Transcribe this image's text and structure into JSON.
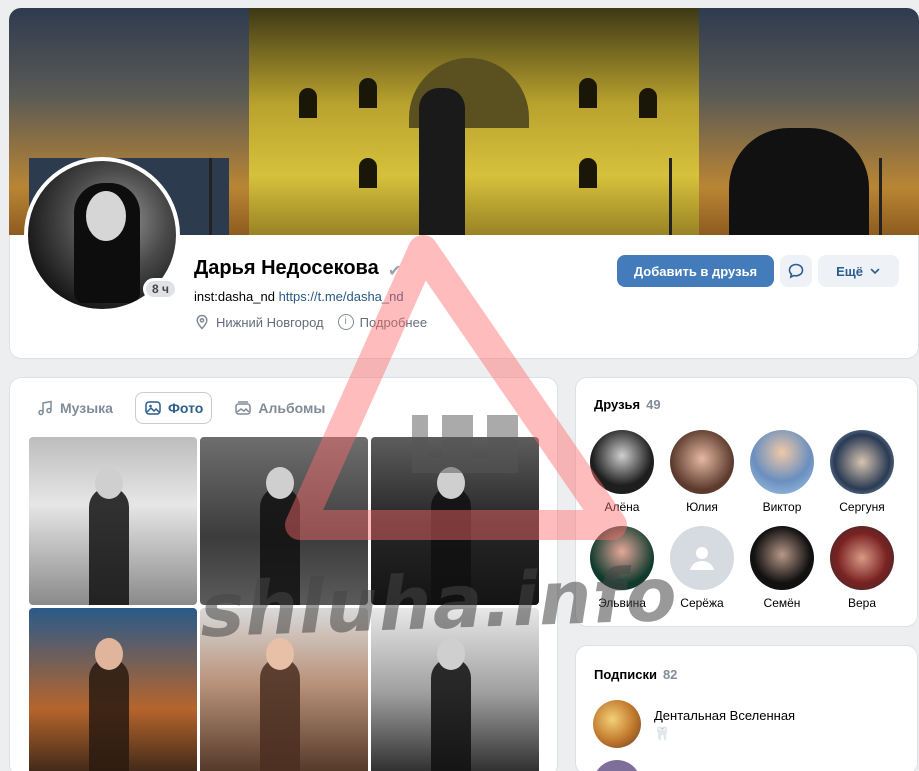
{
  "profile": {
    "name": "Дарья Недосекова",
    "online": "8 ч",
    "bio_prefix": "inst:dasha_nd",
    "bio_link": "https://t.me/dasha_nd",
    "city": "Нижний Новгород",
    "more_info": "Подробнее",
    "add_friend_label": "Добавить в друзья",
    "more_label": "Ещё"
  },
  "tabs": [
    {
      "label": "Музыка",
      "icon": "music-note-icon"
    },
    {
      "label": "Фото",
      "icon": "image-icon",
      "active": true
    },
    {
      "label": "Альбомы",
      "icon": "albums-icon"
    }
  ],
  "friends": {
    "title": "Друзья",
    "count": "49",
    "items": [
      {
        "name": "Алёна"
      },
      {
        "name": "Юлия"
      },
      {
        "name": "Виктор"
      },
      {
        "name": "Сергуня"
      },
      {
        "name": "Эльвина"
      },
      {
        "name": "Серёжа"
      },
      {
        "name": "Семён"
      },
      {
        "name": "Вера"
      }
    ]
  },
  "subscriptions": {
    "title": "Подписки",
    "count": "82",
    "items": [
      {
        "name": "Дентальная Вселенная",
        "emoji": "🦷"
      }
    ]
  },
  "watermark": "shluha.info",
  "colors": {
    "accent": "#447bba",
    "link": "#2a5885",
    "muted": "#818c99",
    "page_bg": "#edeef0",
    "watermark_red": "#ff6b6b"
  }
}
